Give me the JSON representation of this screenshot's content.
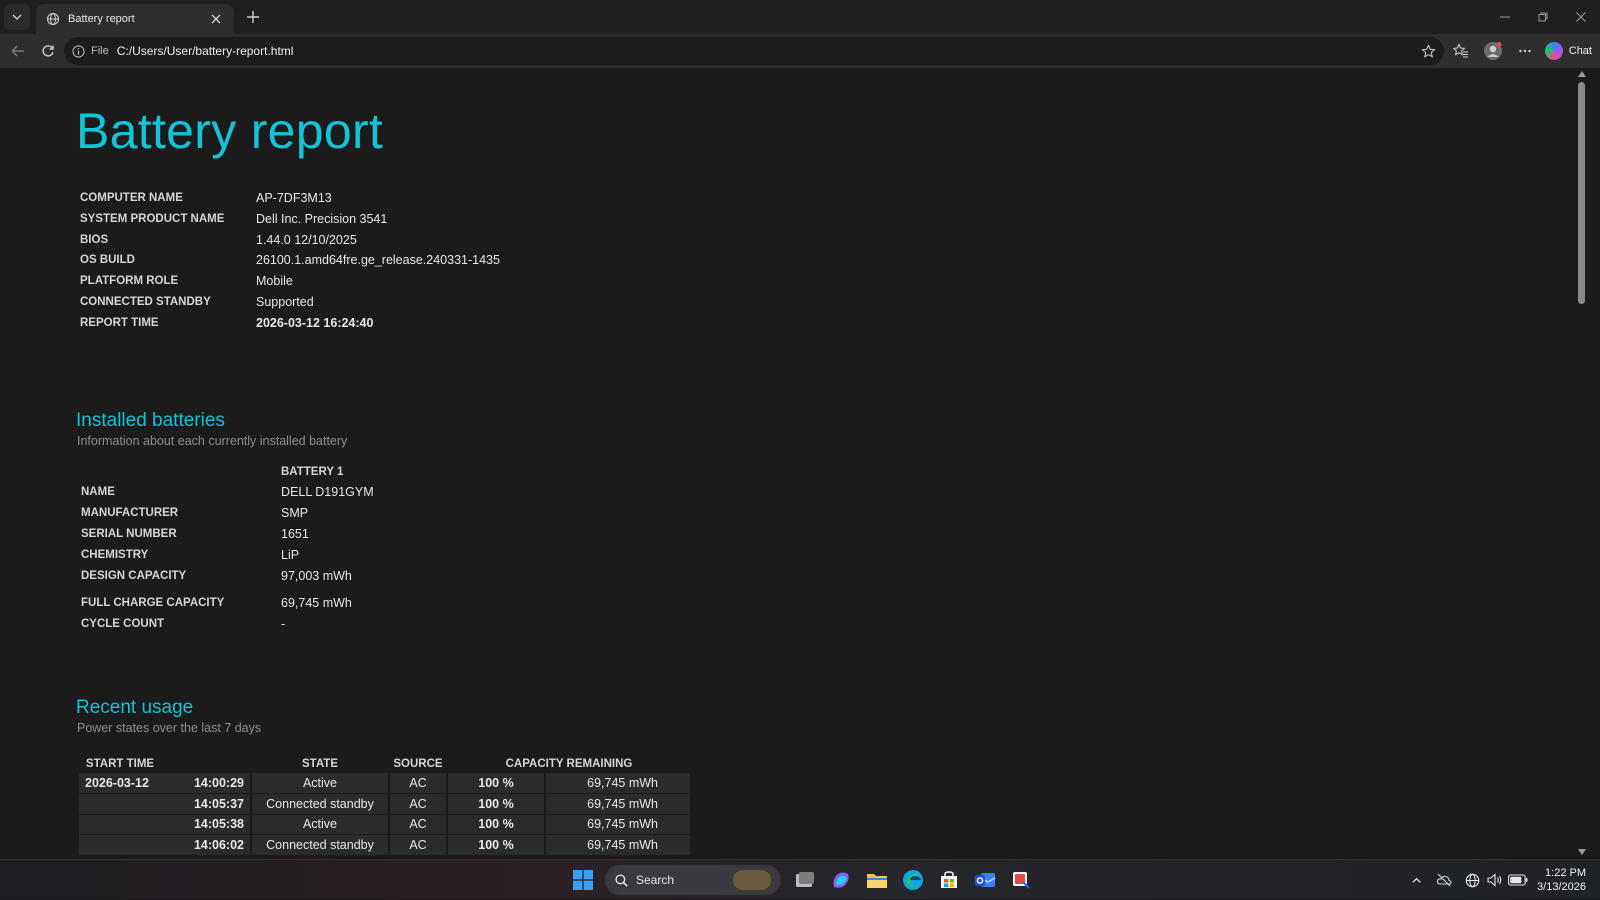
{
  "browser": {
    "tab_title": "Battery report",
    "address_prefix": "File",
    "address_url": "C:/Users/User/battery-report.html",
    "chat_label": "Chat"
  },
  "report": {
    "title": "Battery report",
    "system": [
      {
        "label": "COMPUTER NAME",
        "value": "AP-7DF3M13"
      },
      {
        "label": "SYSTEM PRODUCT NAME",
        "value": "Dell Inc. Precision 3541"
      },
      {
        "label": "BIOS",
        "value": "1.44.0 12/10/2025"
      },
      {
        "label": "OS BUILD",
        "value": "26100.1.amd64fre.ge_release.240331-1435"
      },
      {
        "label": "PLATFORM ROLE",
        "value": "Mobile"
      },
      {
        "label": "CONNECTED STANDBY",
        "value": "Supported"
      },
      {
        "label": "REPORT TIME",
        "value": "2026-03-12  16:24:40"
      }
    ]
  },
  "installed_batteries": {
    "heading": "Installed batteries",
    "subtitle": "Information about each currently installed battery",
    "column_header": "BATTERY 1",
    "rows": [
      {
        "label": "NAME",
        "value": "DELL D191GYM"
      },
      {
        "label": "MANUFACTURER",
        "value": "SMP"
      },
      {
        "label": "SERIAL NUMBER",
        "value": "1651"
      },
      {
        "label": "CHEMISTRY",
        "value": "LiP"
      },
      {
        "label": "DESIGN CAPACITY",
        "value": "97,003 mWh"
      },
      {
        "label": "FULL CHARGE CAPACITY",
        "value": "69,745 mWh"
      },
      {
        "label": "CYCLE COUNT",
        "value": "-"
      }
    ]
  },
  "recent_usage": {
    "heading": "Recent usage",
    "subtitle": "Power states over the last 7 days",
    "headers": {
      "start_time": "START TIME",
      "state": "STATE",
      "source": "SOURCE",
      "capacity": "CAPACITY REMAINING"
    },
    "rows": [
      {
        "date": "2026-03-12",
        "time": "14:00:29",
        "state": "Active",
        "source": "AC",
        "pct": "100 %",
        "mwh": "69,745 mWh"
      },
      {
        "date": "",
        "time": "14:05:37",
        "state": "Connected standby",
        "source": "AC",
        "pct": "100 %",
        "mwh": "69,745 mWh"
      },
      {
        "date": "",
        "time": "14:05:38",
        "state": "Active",
        "source": "AC",
        "pct": "100 %",
        "mwh": "69,745 mWh"
      },
      {
        "date": "",
        "time": "14:06:02",
        "state": "Connected standby",
        "source": "AC",
        "pct": "100 %",
        "mwh": "69,745 mWh"
      }
    ]
  },
  "taskbar": {
    "search_label": "Search",
    "time": "1:22 PM",
    "date": "3/13/2026"
  },
  "colors": {
    "accent": "#15c3d8",
    "background": "#1b1b1b"
  }
}
